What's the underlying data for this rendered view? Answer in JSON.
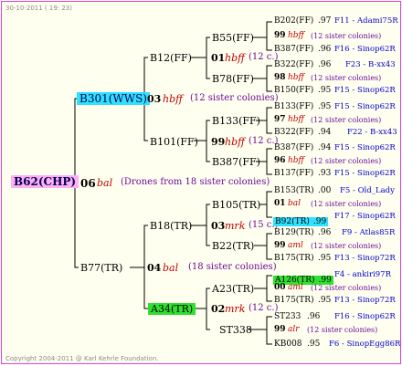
{
  "header": {
    "date": "30-10-2011 ( 19: 23)"
  },
  "footer": {
    "copyright": "Copyright 2004-2011 @ Karl Kehrle Foundation."
  },
  "root": {
    "name": "B62(CHP)",
    "number": "06",
    "code": "bal",
    "drones": "(Drones from 18 sister colonies)"
  },
  "sire": {
    "name": "B301(WWS)",
    "number": "03",
    "code": "hbff",
    "sisters": "(12 sister colonies)"
  },
  "dam": {
    "name": "B77(TR)",
    "number": "04",
    "code": "bal",
    "sisters": "(18 sister colonies)"
  },
  "sire_sire": {
    "name": "B12(FF)",
    "number": "01",
    "code": "hbff",
    "sisters": "(12 c.)"
  },
  "sire_dam": {
    "name": "B101(FF)",
    "number": "99",
    "code": "hbff",
    "sisters": "(12 c.)"
  },
  "dam_sire": {
    "name": "B18(TR)",
    "number": "03",
    "code": "mrk",
    "sisters": "(15 c.)"
  },
  "dam_dam": {
    "name": "A34(TR)",
    "number": "02",
    "code": "mrk",
    "sisters": "(12 c.)"
  },
  "gen3": {
    "b55": "B55(FF)",
    "b78": "B78(FF)",
    "b133": "B133(FF)",
    "b387": "B387(FF)",
    "b105": "B105(TR)",
    "b22": "B22(TR)",
    "a23": "A23(TR)",
    "st338": "ST338"
  },
  "gen4": {
    "r1": {
      "name": "B202(FF)",
      "year": ".97",
      "lineage": "F11 - Adami75R"
    },
    "r2": {
      "number": "99",
      "code": "hbff",
      "sisters": "(12 sister colonies)"
    },
    "r3": {
      "name": "B387(FF)",
      "year": ".96",
      "lineage": "F16 - Sinop62R"
    },
    "r4": {
      "name": "B322(FF)",
      "year": ".96",
      "lineage": "F23 - B-xx43"
    },
    "r5": {
      "number": "98",
      "code": "hbff",
      "sisters": "(12 sister colonies)"
    },
    "r6": {
      "name": "B150(FF)",
      "year": ".95",
      "lineage": "F15 - Sinop62R"
    },
    "r7": {
      "name": "B133(FF)",
      "year": ".95",
      "lineage": "F15 - Sinop62R"
    },
    "r8": {
      "number": "97",
      "code": "hbff",
      "sisters": "(12 sister colonies)"
    },
    "r9": {
      "name": "B322(FF)",
      "year": ".94",
      "lineage": "F22 - B-xx43"
    },
    "r10": {
      "name": "B387(FF)",
      "year": ".94",
      "lineage": "F15 - Sinop62R"
    },
    "r11": {
      "number": "96",
      "code": "hbff",
      "sisters": "(12 sister colonies)"
    },
    "r12": {
      "name": "B137(FF)",
      "year": ".93",
      "lineage": "F15 - Sinop62R"
    },
    "r13": {
      "name": "B153(TR)",
      "year": ".00",
      "lineage": "F5 - Old_Lady"
    },
    "r14": {
      "number": "01",
      "code": "bal",
      "sisters": "(12 sister colonies)"
    },
    "r15": {
      "name": "B92(TR)",
      "year": ".99",
      "lineage": "F17 - Sinop62R"
    },
    "r16": {
      "name": "B129(TR)",
      "year": ".96",
      "lineage": "F9 - Atlas85R"
    },
    "r17": {
      "number": "99",
      "code": "aml",
      "sisters": "(12 sister colonies)"
    },
    "r18": {
      "name": "B175(TR)",
      "year": ".95",
      "lineage": "F13 - Sinop72R"
    },
    "r19": {
      "name": "A126(TR)",
      "year": ".99",
      "lineage": "F4 - ankiri97R"
    },
    "r20": {
      "number": "00",
      "code": "aml",
      "sisters": "(12 sister colonies)"
    },
    "r21": {
      "name": "B175(TR)",
      "year": ".95",
      "lineage": "F13 - Sinop72R"
    },
    "r22": {
      "name": "ST233",
      "year": ".96",
      "lineage": "F16 - Sinop62R"
    },
    "r23": {
      "number": "99",
      "code": "alr",
      "sisters": "(12 sister colonies)"
    },
    "r24": {
      "name": "KB008",
      "year": ".95",
      "lineage": "F6 - SinopEgg86R"
    }
  }
}
